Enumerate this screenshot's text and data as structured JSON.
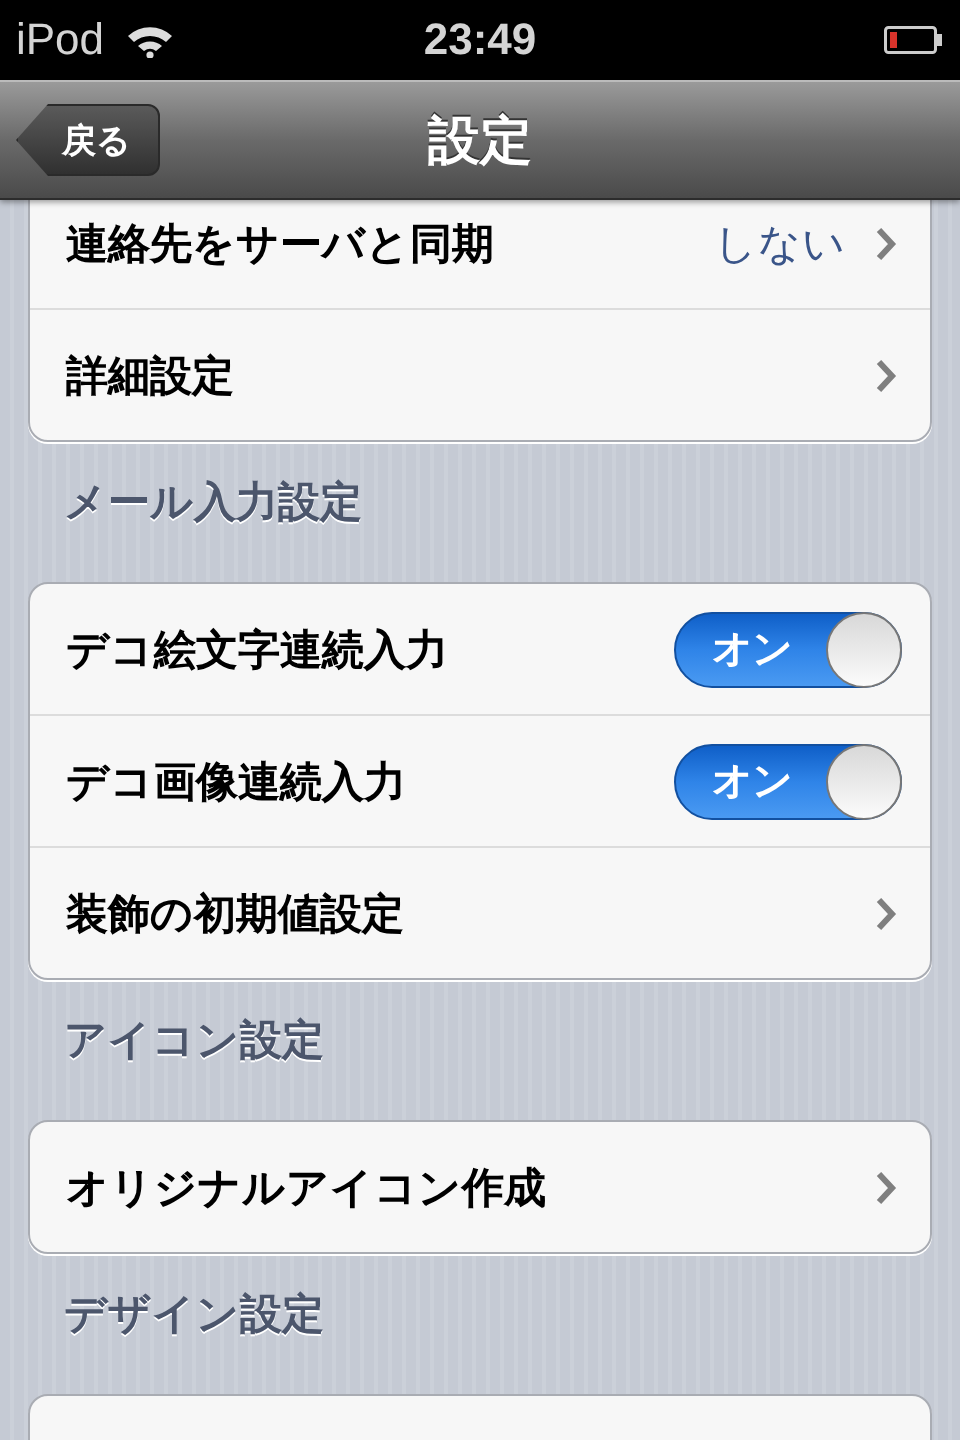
{
  "status_bar": {
    "carrier": "iPod",
    "time": "23:49",
    "battery_low": true
  },
  "nav_bar": {
    "back": "戻る",
    "title": "設定"
  },
  "sections": [
    {
      "rows": [
        {
          "kind": "detail",
          "label": "連絡先をサーバと同期",
          "value": "しない"
        },
        {
          "kind": "link",
          "label": "詳細設定"
        }
      ]
    },
    {
      "header": "メール入力設定",
      "rows": [
        {
          "kind": "toggle",
          "label": "デコ絵文字連続入力",
          "on": true,
          "on_text": "オン"
        },
        {
          "kind": "toggle",
          "label": "デコ画像連続入力",
          "on": true,
          "on_text": "オン"
        },
        {
          "kind": "link",
          "label": "装飾の初期値設定"
        }
      ]
    },
    {
      "header": "アイコン設定",
      "rows": [
        {
          "kind": "link",
          "label": "オリジナルアイコン作成"
        }
      ]
    },
    {
      "header": "デザイン設定"
    }
  ]
}
